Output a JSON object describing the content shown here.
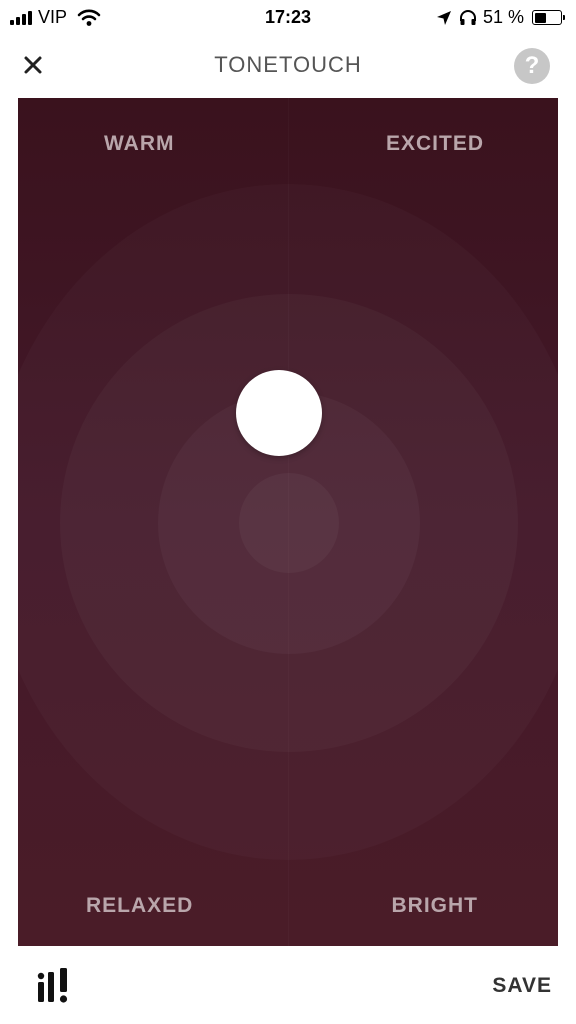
{
  "status_bar": {
    "carrier": "VIP",
    "time": "17:23",
    "battery_text": "51 %",
    "battery_level": 0.51,
    "icons": [
      "signal-icon",
      "wifi-icon",
      "location-icon",
      "headphones-icon",
      "battery-icon"
    ]
  },
  "header": {
    "title": "TONETOUCH",
    "close_icon": "close-icon",
    "help_label": "?"
  },
  "pad": {
    "labels": {
      "top_left": "WARM",
      "top_right": "EXCITED",
      "bottom_left": "RELAXED",
      "bottom_right": "BRIGHT"
    },
    "colors": {
      "background_top": "#3a121d",
      "background_bottom": "#4a1c28",
      "label": "#b9a6ab",
      "knob": "#ffffff"
    }
  },
  "footer": {
    "logo_icon": "brand-logo-icon",
    "save_label": "SAVE"
  }
}
